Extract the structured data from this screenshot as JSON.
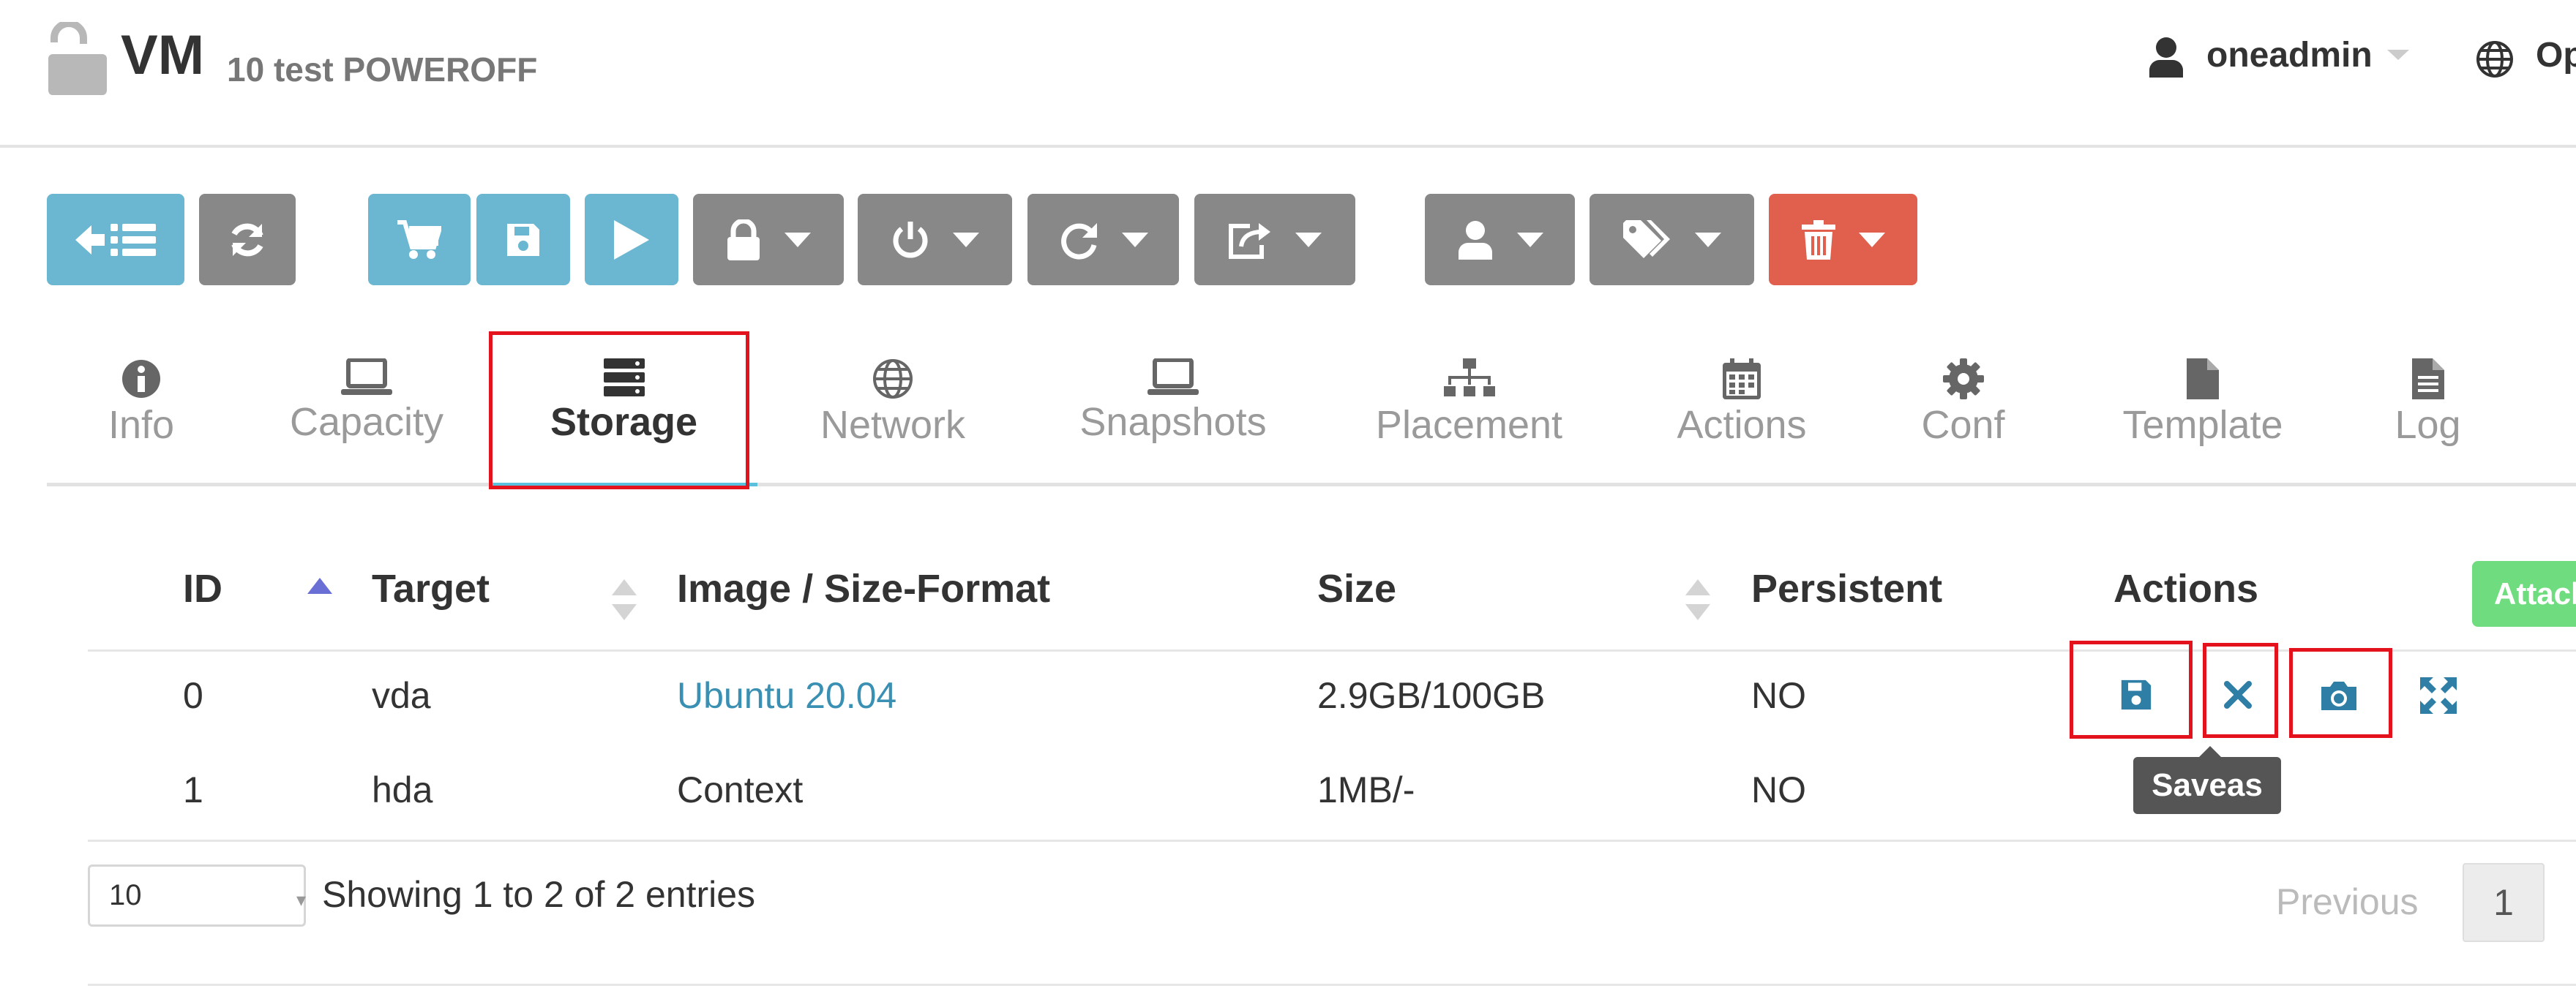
{
  "header": {
    "title": "VM",
    "subtitle": "10 test POWEROFF",
    "user": "oneadmin",
    "language": "Op"
  },
  "toolbar": {
    "buttons": [
      {
        "icon": "back-to-list-icon",
        "color": "#6bb7d1"
      },
      {
        "icon": "refresh-icon",
        "color": "#888888"
      },
      {
        "icon": "deploy-cart-icon",
        "color": "#6bb7d1"
      },
      {
        "icon": "save-icon",
        "color": "#6bb7d1"
      },
      {
        "icon": "play-icon",
        "color": "#6bb7d1"
      },
      {
        "icon": "lock-icon",
        "color": "#888888",
        "dropdown": true
      },
      {
        "icon": "power-icon",
        "color": "#888888",
        "dropdown": true
      },
      {
        "icon": "reboot-icon",
        "color": "#888888",
        "dropdown": true
      },
      {
        "icon": "share-icon",
        "color": "#888888",
        "dropdown": true
      },
      {
        "icon": "user-icon",
        "color": "#888888",
        "dropdown": true
      },
      {
        "icon": "tags-icon",
        "color": "#888888",
        "dropdown": true
      },
      {
        "icon": "trash-icon",
        "color": "#e0604d",
        "dropdown": true
      }
    ]
  },
  "tabs": [
    {
      "label": "Info",
      "icon": "info-icon"
    },
    {
      "label": "Capacity",
      "icon": "laptop-icon"
    },
    {
      "label": "Storage",
      "icon": "storage-icon",
      "active": true
    },
    {
      "label": "Network",
      "icon": "globe-icon"
    },
    {
      "label": "Snapshots",
      "icon": "laptop-icon"
    },
    {
      "label": "Placement",
      "icon": "sitemap-icon"
    },
    {
      "label": "Actions",
      "icon": "calendar-icon"
    },
    {
      "label": "Conf",
      "icon": "gear-icon"
    },
    {
      "label": "Template",
      "icon": "file-icon"
    },
    {
      "label": "Log",
      "icon": "log-file-icon"
    }
  ],
  "table": {
    "columns": [
      "ID",
      "Target",
      "Image / Size-Format",
      "Size",
      "Persistent",
      "Actions"
    ],
    "rows": [
      {
        "id": "0",
        "target": "vda",
        "image": "Ubuntu 20.04",
        "size": "2.9GB/100GB",
        "persistent": "NO"
      },
      {
        "id": "1",
        "target": "hda",
        "image": "Context",
        "size": "1MB/-",
        "persistent": "NO"
      }
    ],
    "attach_label": "Attach",
    "tooltip": "Saveas"
  },
  "footer": {
    "page_length": "10",
    "showing": "Showing 1 to 2 of 2 entries",
    "previous": "Previous",
    "page": "1"
  },
  "colors": {
    "primary": "#6bb7d1",
    "secondary": "#888888",
    "danger": "#e0604d",
    "success": "#6fdc7f",
    "link": "#3a90b3",
    "highlight": "#e3121c"
  }
}
